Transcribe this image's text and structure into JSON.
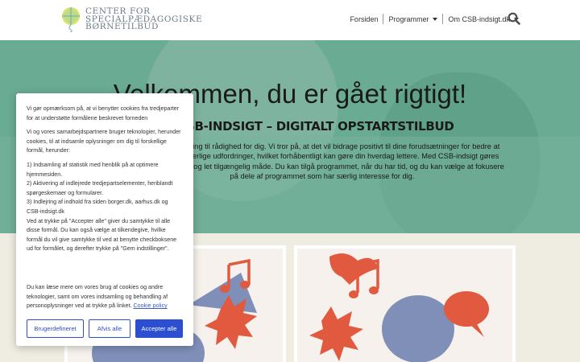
{
  "header": {
    "logo_line1": "Center for",
    "logo_line2": "Specialpædagogiske",
    "logo_line3": "Børnetilbud",
    "nav": [
      {
        "label": "Forsiden"
      },
      {
        "label": "Programmer"
      },
      {
        "label": "Om CSB-indsigt.dk"
      }
    ]
  },
  "hero": {
    "title": "Velkommen, du er gået rigtigt!",
    "subtitle": "CSB-INDSIGT – DIGITALT OPSTARTSTILBUD",
    "paragraph_lines": [
      "…den og erfaring til rådighed for dig. Vi tror på, at det vil bidrage positivt til dine forudsætninger for bedre at",
      "…rtstående særlige udfordringer, hvilket forhåbentligt kan gøre din hverdag lettere. Med CSB-indsigt gøres",
      "…å en fleksibel og let tilgængelig måde. Du kan tilgå programmet, når du har tid, og du kan vælge at fokusere",
      "på dele af programmet som har særlig interesse for dig."
    ]
  },
  "cookie": {
    "p1": "Vi gør opmærksom på, at vi benytter cookies fra tredjeparter for at understøtte formålene beskrevet forneden",
    "p2": "Vi og vores samarbejdspartnere bruger teknologier, herunder cookies, til at indsamle oplysninger om dig til forskellige formål, herunder:",
    "p3": "1) Indsamling af statistik med henblik på at optimere hjemmesiden.\n2) Aktivering af indlejrede tredjepartselementer, heriblandt spørgeskemaer og formularer.\n3) Indlejring af indhold fra siden borger.dk, aarhus.dk og CSB-indsigt.dk\nVed at trykke på \"Accepter alle\" giver du samtykke til alle disse formål. Du kan også vælge at tilkendegive, hvilke formål du vil give samtykke til ved at benytte checkboksene ud for formålet, og derefter trykke på \"Gem indstillinger\".",
    "p4": "Du kan læse mere om vores brug af cookies og andre teknologier, samt om vores indsamling og behandling af personoplysninger ved at trykke på linket.",
    "policy_link": "Cookie policy",
    "btn_custom": "Brugerdefineret",
    "btn_reject": "Afvis alle",
    "btn_accept": "Accepter alle"
  },
  "colors": {
    "accent": "#2b4fd0",
    "hero_green": "#6aab93",
    "illustration_blue": "#7f8fb8",
    "illustration_red": "#e15a3f"
  }
}
